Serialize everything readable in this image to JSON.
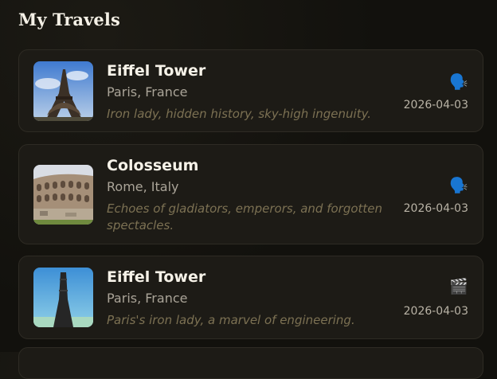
{
  "header": {
    "title": "My Travels"
  },
  "entries": [
    {
      "name": "Eiffel Tower",
      "location": "Paris, France",
      "quote": "Iron lady, hidden history, sky-high ingenuity.",
      "date": "2026-04-03",
      "media_icon": "speaking-head-icon",
      "media_glyph": "🗣️"
    },
    {
      "name": "Colosseum",
      "location": "Rome, Italy",
      "quote": "Echoes of gladiators, emperors, and forgotten spectacles.",
      "date": "2026-04-03",
      "media_icon": "speaking-head-icon",
      "media_glyph": "🗣️"
    },
    {
      "name": "Eiffel Tower",
      "location": "Paris, France",
      "quote": "Paris's iron lady, a marvel of engineering.",
      "date": "2026-04-03",
      "media_icon": "clapper-board-icon",
      "media_glyph": "🎬"
    }
  ],
  "colors": {
    "background": "#12110d",
    "card": "#1d1b16",
    "quote_text": "#7c7153"
  }
}
